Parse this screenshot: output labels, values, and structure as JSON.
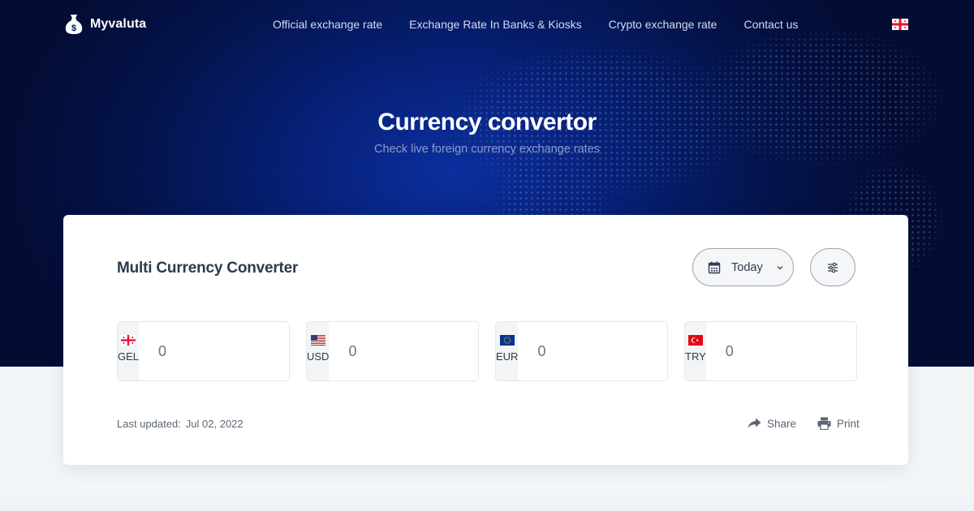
{
  "brand": {
    "name": "Myvaluta"
  },
  "nav": {
    "items": [
      {
        "label": "Official exchange rate"
      },
      {
        "label": "Exchange Rate In Banks & Kiosks"
      },
      {
        "label": "Crypto exchange rate"
      },
      {
        "label": "Contact us"
      }
    ],
    "language_flag": "georgia-flag-icon"
  },
  "hero": {
    "title": "Currency convertor",
    "subtitle": "Check live foreign currency exchange rates"
  },
  "converter": {
    "title": "Multi Currency Converter",
    "date_select": {
      "value": "Today"
    },
    "currencies": [
      {
        "code": "GEL",
        "value": "0",
        "flag": "georgia-flag-icon"
      },
      {
        "code": "USD",
        "value": "0",
        "flag": "usa-flag-icon"
      },
      {
        "code": "EUR",
        "value": "0",
        "flag": "eu-flag-icon"
      },
      {
        "code": "TRY",
        "value": "0",
        "flag": "turkey-flag-icon"
      }
    ],
    "last_updated_label": "Last updated:",
    "last_updated_date": "Jul 02, 2022",
    "share_label": "Share",
    "print_label": "Print"
  },
  "colors": {
    "hero_dark": "#030c33",
    "hero_glow": "#0b2f9e",
    "card_bg": "#ffffff",
    "page_bg": "#f3f6f9"
  }
}
